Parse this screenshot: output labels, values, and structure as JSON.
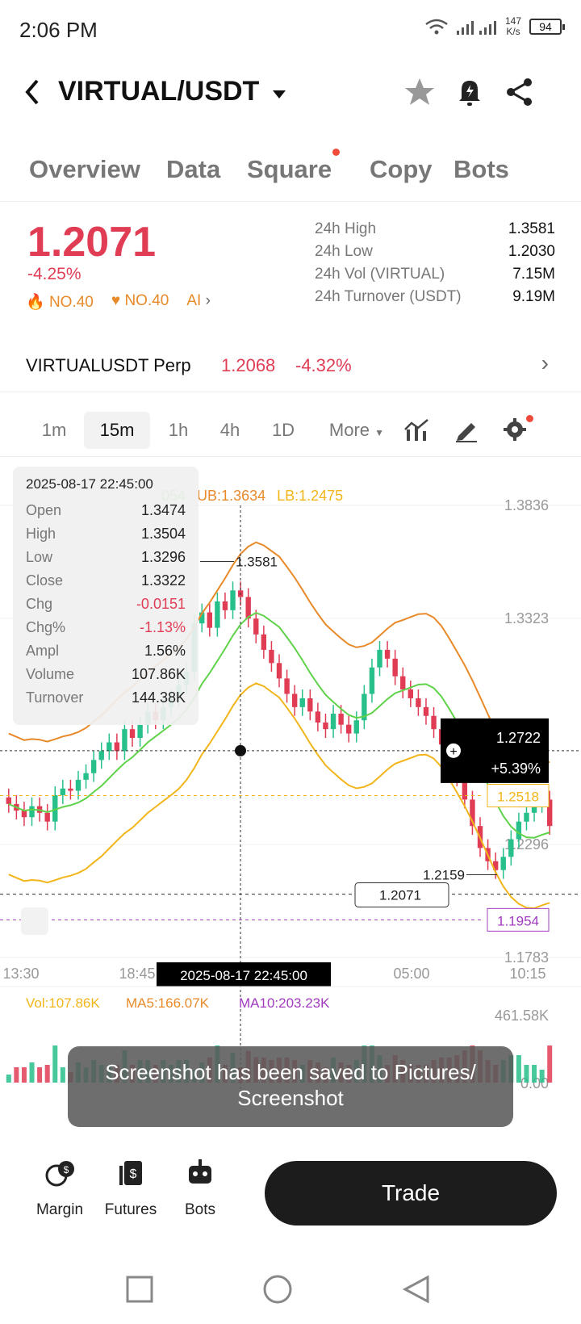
{
  "status_bar": {
    "time": "2:06 PM",
    "net_speed": "147",
    "net_unit": "K/s",
    "battery": "94"
  },
  "header": {
    "pair": "VIRTUAL/USDT"
  },
  "tabs": [
    {
      "label": "Overview"
    },
    {
      "label": "Data"
    },
    {
      "label": "Square"
    },
    {
      "label": "Copy"
    },
    {
      "label": "Bots"
    }
  ],
  "price": {
    "last": "1.2071",
    "change": "-4.25%",
    "rank1": "NO.40",
    "rank2": "NO.40",
    "ai": "AI",
    "stats": [
      {
        "label": "24h High",
        "value": "1.3581"
      },
      {
        "label": "24h Low",
        "value": "1.2030"
      },
      {
        "label": "24h Vol (VIRTUAL)",
        "value": "7.15M"
      },
      {
        "label": "24h Turnover (USDT)",
        "value": "9.19M"
      }
    ]
  },
  "perp": {
    "name": "VIRTUALUSDT Perp",
    "price": "1.2068",
    "change": "-4.32%"
  },
  "intervals": [
    "1m",
    "15m",
    "1h",
    "4h",
    "1D",
    "More"
  ],
  "colors": {
    "down": "#e03d55",
    "up": "#27c08a",
    "ub": "#e88a2a",
    "lb": "#f2b51a",
    "mid": "#5fd24a"
  },
  "ohlc": {
    "datetime": "2025-08-17 22:45:00",
    "rows": [
      {
        "label": "Open",
        "value": "1.3474"
      },
      {
        "label": "High",
        "value": "1.3504"
      },
      {
        "label": "Low",
        "value": "1.3296"
      },
      {
        "label": "Close",
        "value": "1.3322"
      },
      {
        "label": "Chg",
        "value": "-0.0151"
      },
      {
        "label": "Chg%",
        "value": "-1.13%"
      },
      {
        "label": "Ampl",
        "value": "1.56%"
      },
      {
        "label": "Volume",
        "value": "107.86K"
      },
      {
        "label": "Turnover",
        "value": "144.38K"
      }
    ]
  },
  "bollinger": {
    "mid_frag": "054",
    "ub": "UB:1.3634",
    "lb": "LB:1.2475"
  },
  "chart_data": {
    "type": "candlestick",
    "y_ticks": [
      "1.3836",
      "1.3323",
      "1.2296",
      "1.1783"
    ],
    "x_ticks": [
      "13:30",
      "18:45",
      "05:00",
      "10:15"
    ],
    "ylim": [
      1.1783,
      1.3836
    ],
    "crosshair_time": "2025-08-17 22:45:00",
    "crosshair_value": "1.2722",
    "crosshair_pct": "+5.39%",
    "high_marker": "1.3581",
    "low_marker": "1.2159",
    "last_price_label": "1.2071",
    "lb_tag": "1.2518",
    "ma_tag": "1.1954",
    "volume": {
      "vol": "Vol:107.86K",
      "ma5": "MA5:166.07K",
      "ma10": "MA10:203.23K",
      "max": "461.58K",
      "min": "0.00"
    },
    "candles_close": [
      1.248,
      1.245,
      1.242,
      1.247,
      1.244,
      1.24,
      1.252,
      1.255,
      1.254,
      1.259,
      1.262,
      1.268,
      1.272,
      1.276,
      1.272,
      1.282,
      1.278,
      1.284,
      1.29,
      1.286,
      1.292,
      1.296,
      1.302,
      1.308,
      1.33,
      1.335,
      1.328,
      1.34,
      1.336,
      1.345,
      1.342,
      1.3322,
      1.325,
      1.318,
      1.312,
      1.305,
      1.298,
      1.292,
      1.296,
      1.29,
      1.285,
      1.282,
      1.289,
      1.284,
      1.28,
      1.286,
      1.298,
      1.31,
      1.318,
      1.314,
      1.306,
      1.3,
      1.296,
      1.292,
      1.288,
      1.282,
      1.275,
      1.268,
      1.26,
      1.25,
      1.238,
      1.228,
      1.222,
      1.218,
      1.224,
      1.232,
      1.24,
      1.244,
      1.248,
      1.25,
      1.238
    ]
  },
  "toast": "Screenshot has been saved to  Pictures/ Screenshot",
  "bottom_nav": [
    {
      "label": "Margin"
    },
    {
      "label": "Futures"
    },
    {
      "label": "Bots"
    }
  ],
  "trade_label": "Trade"
}
